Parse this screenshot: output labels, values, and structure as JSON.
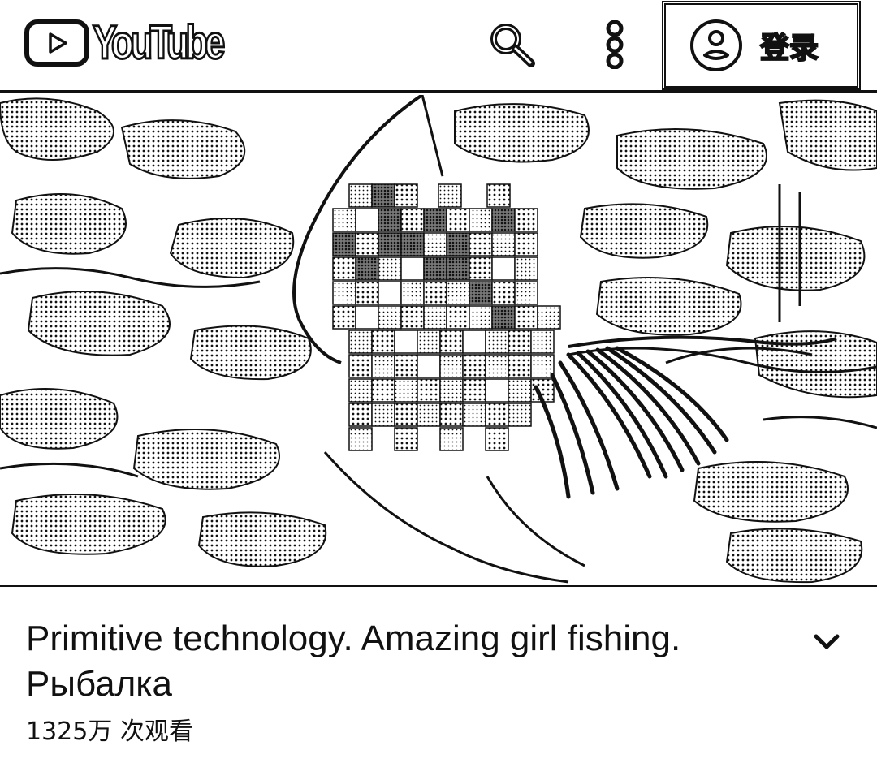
{
  "header": {
    "logo_text": "YouTube",
    "logo_icon": "youtube-play-icon",
    "search_icon": "search-icon",
    "more_icon": "more-vertical-icon",
    "signin": {
      "icon": "account-circle-icon",
      "label": "登录"
    }
  },
  "video": {
    "thumbnail_icon": "video-thumbnail"
  },
  "info": {
    "title": "Primitive technology. Amazing girl fishing. Рыбалка",
    "expand_icon": "chevron-down-icon",
    "views": "1325万 次观看"
  },
  "colors": {
    "foreground": "#111111",
    "background": "#ffffff"
  }
}
